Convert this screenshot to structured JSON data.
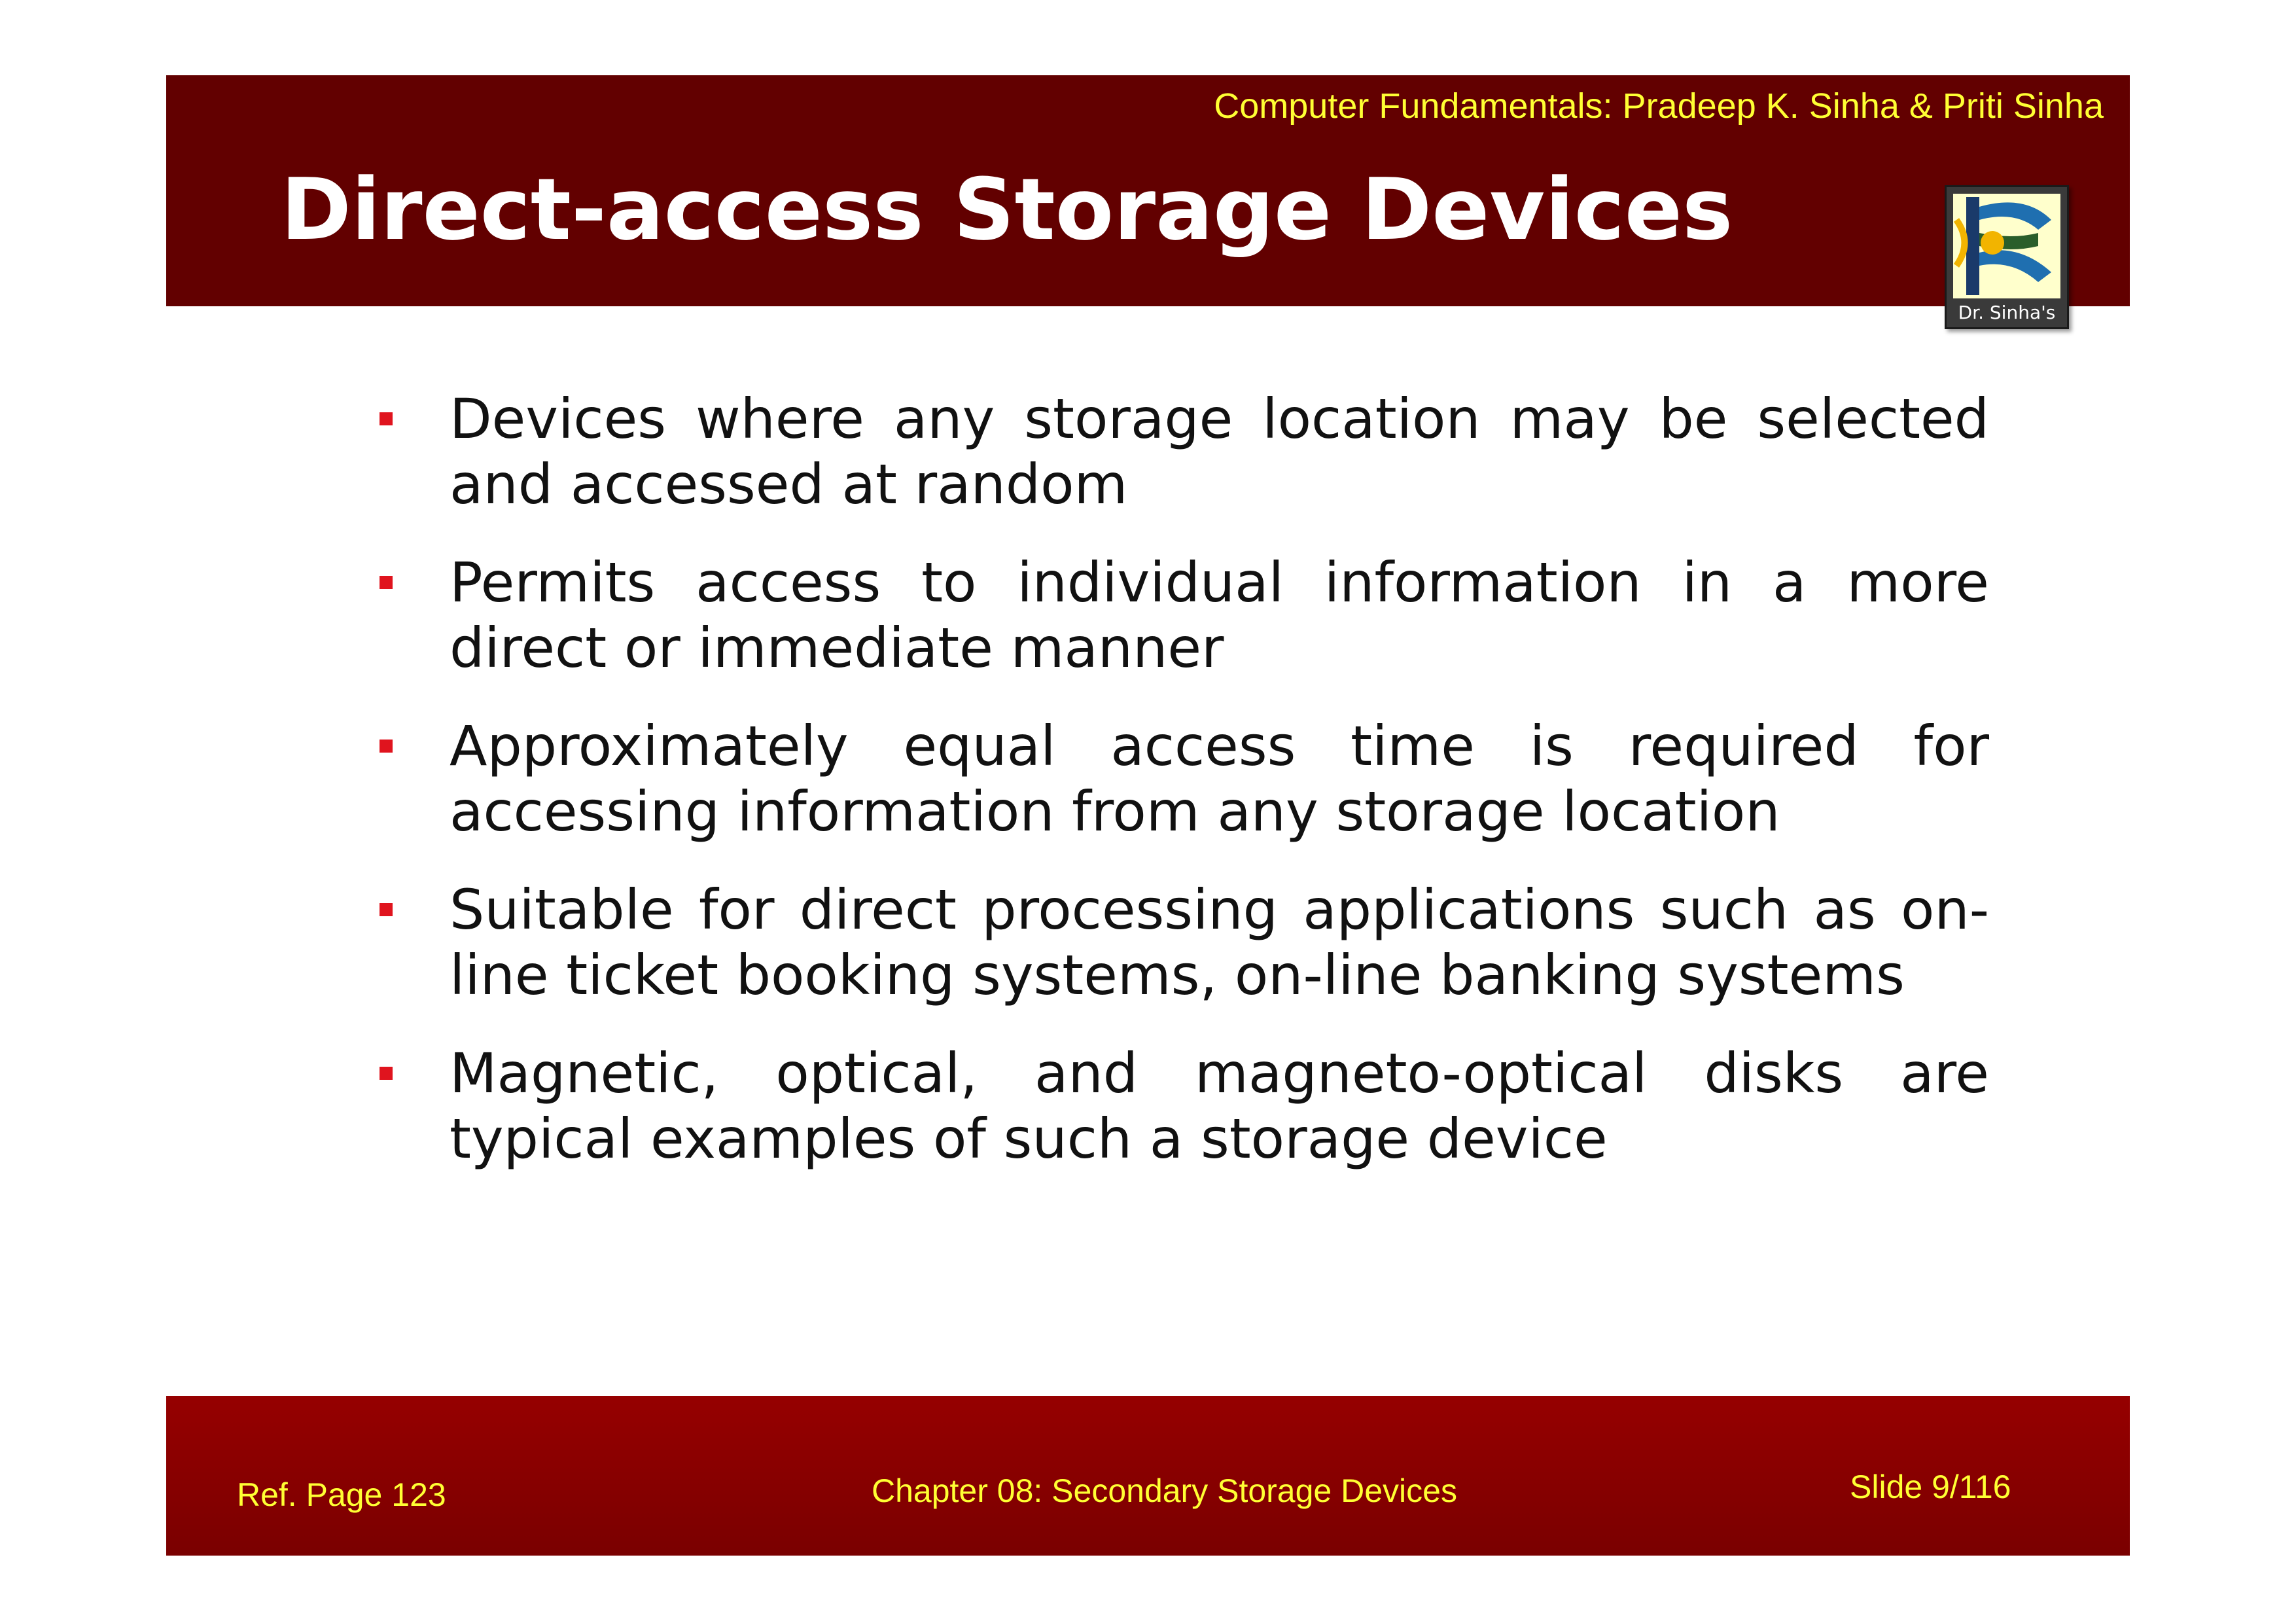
{
  "header": {
    "credit": "Computer Fundamentals: Pradeep K. Sinha & Priti Sinha",
    "title": "Direct-access Storage Devices",
    "logo_caption": "Dr. Sinha's"
  },
  "bullets": [
    {
      "text": "Devices where any storage location may be selected and accessed at random"
    },
    {
      "text": "Permits access to individual information in a more direct or immediate manner"
    },
    {
      "text": "Approximately equal access time is required for accessing information from any storage location"
    },
    {
      "text": "Suitable for direct processing applications such as on-line ticket booking systems, on-line banking systems"
    },
    {
      "text": "Magnetic, optical, and magneto-optical disks are typical examples of such a storage device"
    }
  ],
  "footer": {
    "ref_page": "Ref. Page  123",
    "chapter": "Chapter 08: Secondary Storage Devices",
    "slide": "Slide 9/116"
  },
  "colors": {
    "header_background": "#620000",
    "footer_background": "#8a0000",
    "accent_text": "#ffff33",
    "bullet_marker": "#e0141e"
  },
  "icons": {
    "bullet": "square-bullet-icon",
    "logo": "dr-sinhas-logo-icon"
  }
}
